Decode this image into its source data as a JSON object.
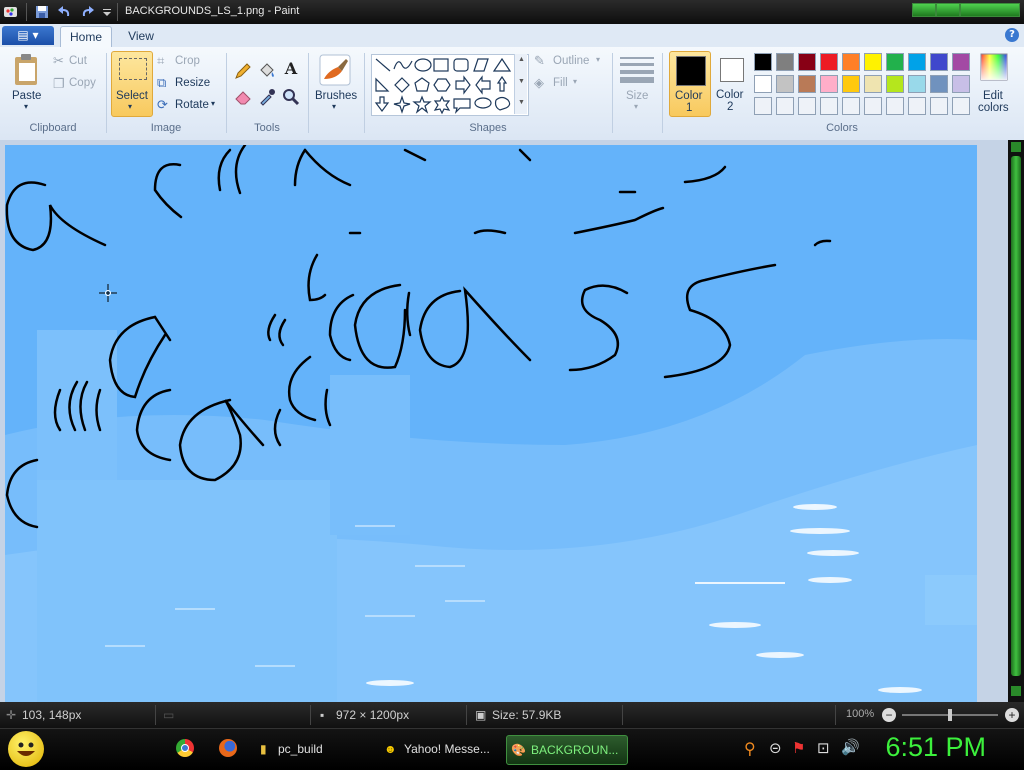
{
  "window": {
    "title": "BACKGROUNDS_LS_1.png - Paint"
  },
  "tabs": {
    "file_icon": "menu-icon",
    "home": "Home",
    "view": "View",
    "help": "?"
  },
  "ribbon": {
    "clipboard": {
      "paste": "Paste",
      "cut": "Cut",
      "copy": "Copy",
      "group": "Clipboard"
    },
    "image": {
      "select": "Select",
      "crop": "Crop",
      "resize": "Resize",
      "rotate": "Rotate",
      "group": "Image"
    },
    "tools": {
      "group": "Tools"
    },
    "brushes": {
      "label": "Brushes"
    },
    "shapes": {
      "outline": "Outline",
      "fill": "Fill",
      "group": "Shapes"
    },
    "size": {
      "label": "Size"
    },
    "colors": {
      "color1_label": "Color",
      "color1_num": "1",
      "color2_label": "Color",
      "color2_num": "2",
      "edit_line1": "Edit",
      "edit_line2": "colors",
      "group": "Colors",
      "color1": "#000000",
      "color2": "#ffffff",
      "palette_row1": [
        "#000000",
        "#7f7f7f",
        "#880015",
        "#ed1c24",
        "#ff7f27",
        "#fff200",
        "#22b14c",
        "#00a2e8",
        "#3f48cc",
        "#a349a4"
      ],
      "palette_row2": [
        "#ffffff",
        "#c3c3c3",
        "#b97a57",
        "#ffaec9",
        "#ffc90e",
        "#efe4b0",
        "#b5e61d",
        "#99d9ea",
        "#7092be",
        "#c8bfe7"
      ],
      "palette_row3": [
        "#eef2f8",
        "#eef2f8",
        "#eef2f8",
        "#eef2f8",
        "#eef2f8",
        "#eef2f8",
        "#eef2f8",
        "#eef2f8",
        "#eef2f8",
        "#eef2f8"
      ]
    }
  },
  "statusbar": {
    "cursor_pos": "103, 148px",
    "image_size": "972 × 1200px",
    "file_size": "Size: 57.9KB",
    "zoom": "100%",
    "zoom_level": 1.0
  },
  "taskbar": {
    "items": [
      {
        "label": "pc_build"
      },
      {
        "label": "Yahoo! Messe..."
      },
      {
        "label": "BACKGROUN..."
      }
    ],
    "clock": "6:51 PM"
  },
  "colors": {
    "sky": "#6bb8fb",
    "canvas_dark": "#5aaaf5",
    "accent_green": "#3cf03c"
  }
}
